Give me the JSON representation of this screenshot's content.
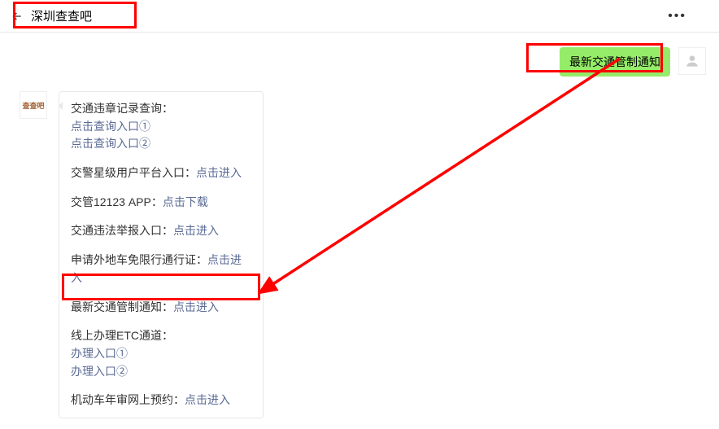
{
  "header": {
    "title": "深圳查查吧"
  },
  "user_message": "最新交通管制通知",
  "bot_avatar_text": "查查吧",
  "bot_reply": {
    "s1": {
      "title": "交通违章记录查询：",
      "link1": "点击查询入口①",
      "link2": "点击查询入口②"
    },
    "s2": {
      "label": "交警星级用户平台入口：",
      "link": "点击进入"
    },
    "s3": {
      "label": "交管12123 APP：",
      "link": "点击下载"
    },
    "s4": {
      "label": "交通违法举报入口：",
      "link": "点击进入"
    },
    "s5": {
      "label": "申请外地车免限行通行证：",
      "link": "点击进入"
    },
    "s6": {
      "label": "最新交通管制通知：",
      "link": "点击进入"
    },
    "s7": {
      "title": "线上办理ETC通道：",
      "link1": "办理入口①",
      "link2": "办理入口②"
    },
    "s8": {
      "label": "机动车年审网上预约：",
      "link": "点击进入"
    }
  }
}
